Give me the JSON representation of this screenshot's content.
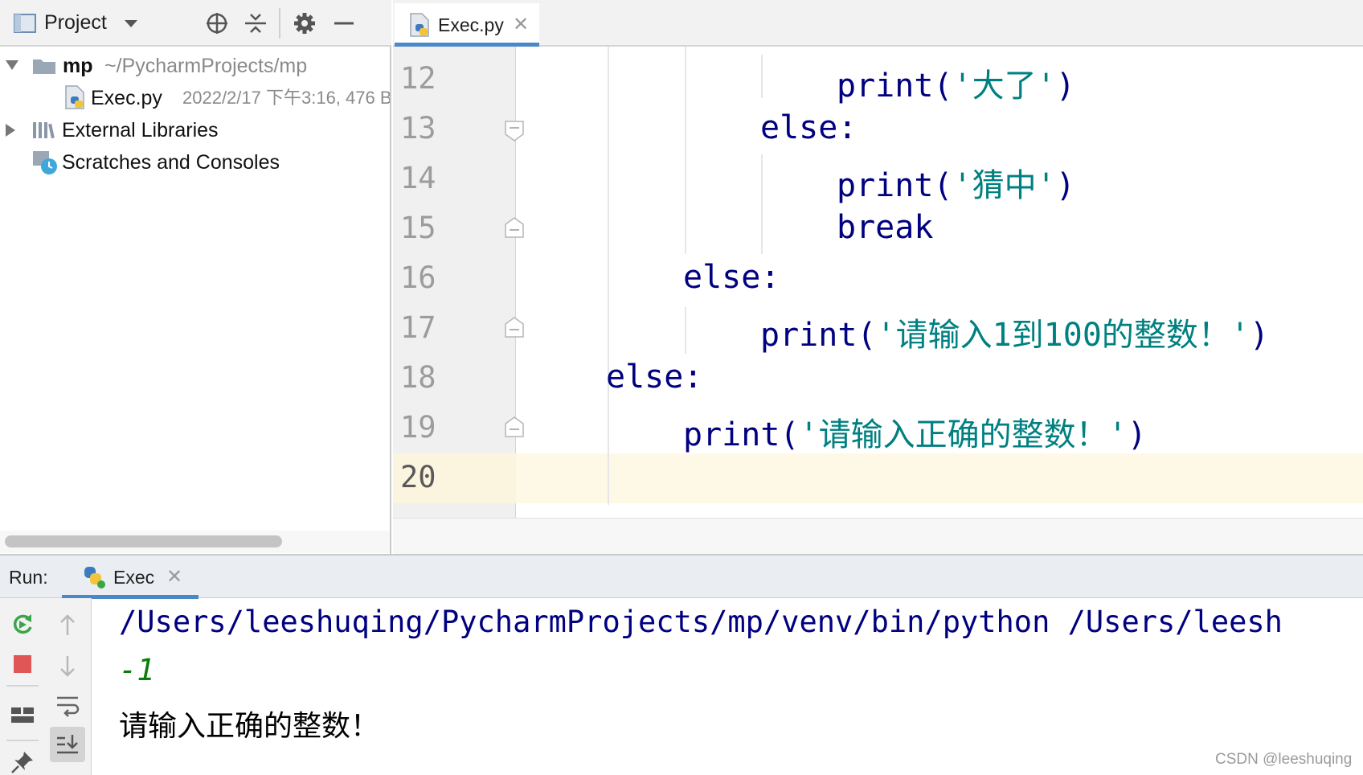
{
  "project_panel": {
    "title": "Project",
    "tree": [
      {
        "name": "mp",
        "path": "~/PycharmProjects/mp"
      },
      {
        "name": "Exec.py",
        "meta": "2022/2/17 下午3:16, 476 B"
      },
      {
        "name": "External Libraries"
      },
      {
        "name": "Scratches and Consoles"
      }
    ]
  },
  "editor": {
    "tab": {
      "label": "Exec.py"
    },
    "line_numbers": [
      "12",
      "13",
      "14",
      "15",
      "16",
      "17",
      "18",
      "19",
      "20"
    ],
    "code": {
      "l12_kw": "print",
      "l12_open": "(",
      "l12_str": "'大了'",
      "l12_close": ")",
      "l13": "else:",
      "l14_kw": "print",
      "l14_open": "(",
      "l14_str": "'猜中'",
      "l14_close": ")",
      "l15": "break",
      "l16": "else:",
      "l17_kw": "print",
      "l17_open": "(",
      "l17_str": "'请输入1到100的整数！'",
      "l17_close": ")",
      "l18": "else:",
      "l19_kw": "print",
      "l19_open": "(",
      "l19_str": "'请输入正确的整数！'",
      "l19_close": ")"
    },
    "current_line": "20"
  },
  "run_panel": {
    "label": "Run:",
    "tab_label": "Exec",
    "console": {
      "command": "/Users/leeshuqing/PycharmProjects/mp/venv/bin/python /Users/leesh",
      "input": "-1",
      "output": "请输入正确的整数！"
    }
  },
  "watermark": "CSDN @leeshuqing",
  "colors": {
    "keyword": "#000080",
    "string": "#008080",
    "input": "#0a7d0a",
    "accent": "#4a88c7",
    "current_line_bg": "#fdf9e6"
  }
}
